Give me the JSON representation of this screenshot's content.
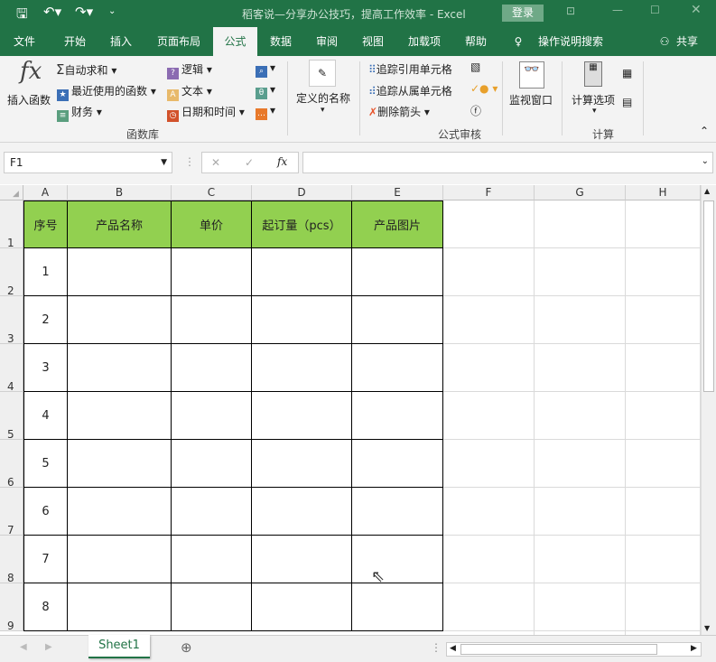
{
  "title_bar": {
    "title": "稻客说—分享办公技巧，提高工作效率  -  Excel",
    "login": "登录",
    "qat_more": "⌄"
  },
  "tabs": [
    "文件",
    "开始",
    "插入",
    "页面布局",
    "公式",
    "数据",
    "审阅",
    "视图",
    "加载项",
    "帮助"
  ],
  "tell_me": "操作说明搜索",
  "share": "共享",
  "ribbon": {
    "insert_function": "插入函数",
    "autosum": "自动求和",
    "recent": "最近使用的函数",
    "financial": "财务",
    "logical": "逻辑",
    "text": "文本",
    "datetime": "日期和时间",
    "group_library": "函数库",
    "defined_names": "定义的名称",
    "trace_precedents": "追踪引用单元格",
    "trace_dependents": "追踪从属单元格",
    "remove_arrows": "删除箭头",
    "group_audit": "公式审核",
    "watch_window": "监视窗口",
    "calc_options": "计算选项",
    "group_calc": "计算"
  },
  "formula_bar": {
    "name_box": "F1",
    "fx": "fx",
    "value": ""
  },
  "columns": [
    "A",
    "B",
    "C",
    "D",
    "E",
    "F",
    "G",
    "H"
  ],
  "rows": [
    "1",
    "2",
    "3",
    "4",
    "5",
    "6",
    "7",
    "8",
    "9"
  ],
  "table": {
    "headers": [
      "序号",
      "产品名称",
      "单价",
      "起订量（pcs）",
      "产品图片"
    ],
    "serials": [
      "1",
      "2",
      "3",
      "4",
      "5",
      "6",
      "7",
      "8"
    ]
  },
  "sheet_tabs": [
    "Sheet1"
  ],
  "colors": {
    "excel_green": "#217346",
    "header_fill": "#92d050"
  }
}
